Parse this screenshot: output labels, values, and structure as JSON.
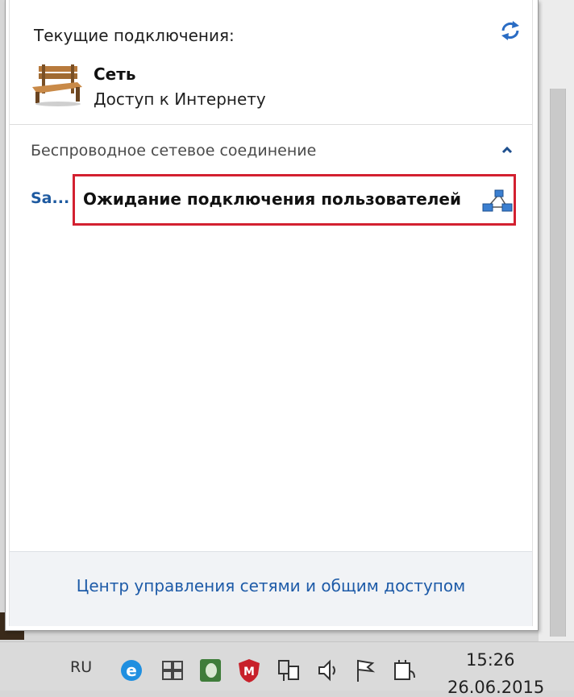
{
  "flyout": {
    "current_connections_label": "Текущие подключения:",
    "network": {
      "name": "Сеть",
      "status": "Доступ к Интернету"
    },
    "wireless_section_title": "Беспроводное сетевое соединение",
    "adhoc_network": {
      "name": "Sa...",
      "status": "Ожидание подключения пользователей"
    },
    "footer_link": "Центр управления сетями и общим доступом",
    "highlight_color": "#d32030"
  },
  "taskbar": {
    "language": "RU",
    "time": "15:26",
    "date": "26.06.2015",
    "icons": [
      "ie-icon",
      "windows-icon",
      "evernote-icon",
      "mcafee-icon",
      "network-icon",
      "volume-icon",
      "flag-icon",
      "power-icon"
    ]
  }
}
